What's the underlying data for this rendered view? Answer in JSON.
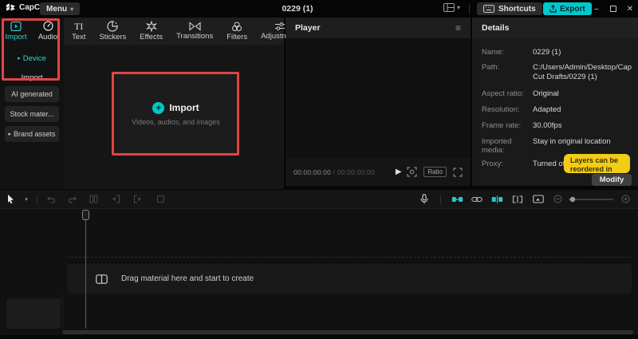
{
  "topbar": {
    "logo_text": "CapCut",
    "menu_label": "Menu",
    "doc_title": "0229 (1)",
    "shortcuts_label": "Shortcuts",
    "export_label": "Export"
  },
  "glyphs": {
    "chevron_down": "▾",
    "play": "▶",
    "plus": "+",
    "hamburger": "≡",
    "minimize": "–",
    "close": "✕",
    "caret_right": "▸",
    "caret_down": "▾",
    "text_tool": "TI"
  },
  "media_panel": {
    "tabs": [
      {
        "label": "Import"
      },
      {
        "label": "Audio"
      }
    ],
    "toolbar": [
      "Text",
      "Stickers",
      "Effects",
      "Transitions",
      "Filters",
      "Adjustment"
    ],
    "sidebar_items": [
      {
        "label": "Device"
      },
      {
        "label": "Import"
      }
    ],
    "sidebar_buttons": [
      {
        "label": "AI generated"
      },
      {
        "label": "Stock mater..."
      },
      {
        "label": "Brand assets"
      }
    ],
    "dropzone": {
      "title": "Import",
      "subtitle": "Videos, audios, and images"
    }
  },
  "player": {
    "title": "Player",
    "timecode_current": "00:00:00:00",
    "timecode_separator": " / ",
    "timecode_total": "00:00:00:00",
    "ratio_label": "Ratio"
  },
  "details": {
    "title": "Details",
    "rows": [
      {
        "label": "Name:",
        "value": "0229 (1)"
      },
      {
        "label": "Path:",
        "value": "C:/Users/Admin/Desktop/CapCut Drafts/0229 (1)"
      },
      {
        "label": "Aspect ratio:",
        "value": "Original"
      },
      {
        "label": "Resolution:",
        "value": "Adapted"
      },
      {
        "label": "Frame rate:",
        "value": "30.00fps"
      },
      {
        "label": "Imported media:",
        "value": "Stay in original location"
      },
      {
        "label": "Proxy:",
        "value": "Turned off"
      }
    ],
    "tooltip_text": "Layers can be reordered in",
    "modify_label": "Modify"
  },
  "timeline": {
    "drop_text": "Drag material here and start to create"
  },
  "colors": {
    "accent_teal": "#00c8cc",
    "highlight_red": "#e04545",
    "tooltip_yellow": "#f2cc16"
  }
}
